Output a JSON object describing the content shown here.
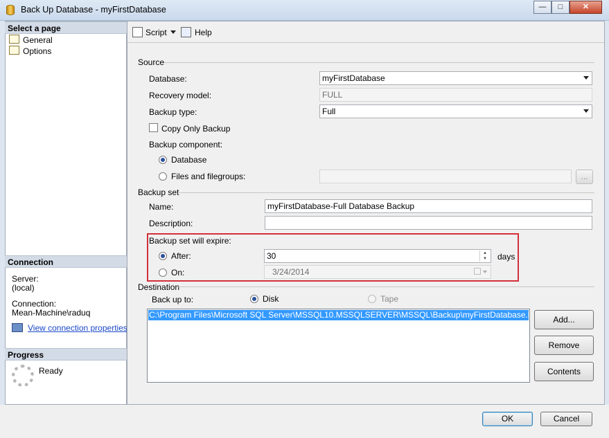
{
  "window": {
    "title": "Back Up Database - myFirstDatabase"
  },
  "left": {
    "select_page": "Select a page",
    "pages": [
      {
        "label": "General"
      },
      {
        "label": "Options"
      }
    ],
    "connection": {
      "header": "Connection",
      "server_label": "Server:",
      "server_value": "(local)",
      "connection_label": "Connection:",
      "connection_value": "Mean-Machine\\raduq",
      "view_link": "View connection properties"
    },
    "progress": {
      "header": "Progress",
      "status": "Ready"
    }
  },
  "toolbar": {
    "script": "Script",
    "help": "Help"
  },
  "source": {
    "title": "Source",
    "database_label": "Database:",
    "database_value": "myFirstDatabase",
    "recovery_label": "Recovery model:",
    "recovery_value": "FULL",
    "backup_type_label": "Backup type:",
    "backup_type_value": "Full",
    "copy_only": "Copy Only Backup",
    "component_label": "Backup component:",
    "component_database": "Database",
    "component_files": "Files and filegroups:",
    "browse": "..."
  },
  "backup_set": {
    "title": "Backup set",
    "name_label": "Name:",
    "name_value": "myFirstDatabase-Full Database Backup",
    "description_label": "Description:",
    "description_value": "",
    "expire_label": "Backup set will expire:",
    "after_label": "After:",
    "after_value": "30",
    "days": "days",
    "on_label": "On:",
    "on_value": "3/24/2014"
  },
  "destination": {
    "title": "Destination",
    "backup_to_label": "Back up to:",
    "disk": "Disk",
    "tape": "Tape",
    "paths": [
      "C:\\Program Files\\Microsoft SQL Server\\MSSQL10.MSSQLSERVER\\MSSQL\\Backup\\myFirstDatabase.bak"
    ],
    "add": "Add...",
    "remove": "Remove",
    "contents": "Contents"
  },
  "footer": {
    "ok": "OK",
    "cancel": "Cancel"
  },
  "colors": {
    "highlight_box": "#d32f3a",
    "selection": "#3399ff"
  }
}
